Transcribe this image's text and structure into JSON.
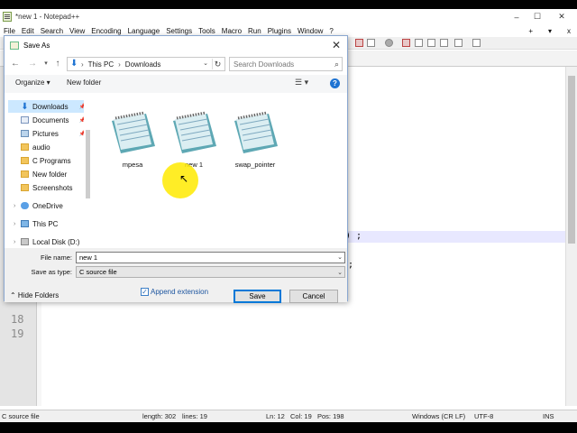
{
  "app": {
    "title": "*new 1 - Notepad++",
    "menu": [
      "File",
      "Edit",
      "Search",
      "View",
      "Encoding",
      "Language",
      "Settings",
      "Tools",
      "Macro",
      "Run",
      "Plugins",
      "Window",
      "?"
    ],
    "menu_right": [
      "+",
      "▾",
      "x"
    ],
    "window_controls": {
      "minimize": "–",
      "maximize": "☐",
      "close": "✕"
    }
  },
  "editor": {
    "line_numbers": [
      "18",
      "19"
    ],
    "code_fragments": [
      ") ;",
      ";"
    ]
  },
  "status_bar": {
    "file_type": "C source file",
    "length": "length: 302",
    "lines": "lines: 19",
    "ln": "Ln: 12",
    "col": "Col: 19",
    "pos": "Pos: 198",
    "eol": "Windows (CR LF)",
    "encoding": "UTF-8",
    "mode": "INS"
  },
  "dialog": {
    "title": "Save As",
    "close_glyph": "✕",
    "nav": {
      "back": "←",
      "forward": "→",
      "recent": "▾",
      "up": "↑"
    },
    "breadcrumb": [
      "This PC",
      "Downloads"
    ],
    "breadcrumb_sep": "›",
    "refresh_glyph": "↻",
    "search_placeholder": "Search Downloads",
    "search_glyph": "⌕",
    "organize": "Organize ▾",
    "new_folder": "New folder",
    "view_glyph": "☰ ▾",
    "help_glyph": "?",
    "tree": [
      {
        "label": "Downloads",
        "icon": "download-icon",
        "pinned": true,
        "selected": true
      },
      {
        "label": "Documents",
        "icon": "document-icon",
        "pinned": true
      },
      {
        "label": "Pictures",
        "icon": "pictures-icon",
        "pinned": true
      },
      {
        "label": "audio",
        "icon": "folder-icon"
      },
      {
        "label": "C Programs",
        "icon": "folder-icon"
      },
      {
        "label": "New folder",
        "icon": "folder-icon"
      },
      {
        "label": "Screenshots",
        "icon": "folder-icon"
      },
      {
        "label": "OneDrive",
        "icon": "onedrive-icon"
      },
      {
        "label": "This PC",
        "icon": "this-pc-icon"
      },
      {
        "label": "Local Disk (D:)",
        "icon": "disk-icon"
      }
    ],
    "pin_glyph": "📌",
    "expand_glyph": "›",
    "files": [
      {
        "name": "mpesa",
        "icon": "notepad-icon"
      },
      {
        "name": "new 1",
        "icon": "notepad-icon"
      },
      {
        "name": "swap_pointer",
        "icon": "notepad-icon"
      }
    ],
    "file_name_label": "File name:",
    "file_name_value": "new 1",
    "save_type_label": "Save as type:",
    "save_type_value": "C source file",
    "dropdown_glyph": "⌄",
    "hide_folders": "⌃  Hide Folders",
    "append_extension": "Append extension",
    "append_checked": "✓",
    "save_button": "Save",
    "cancel_button": "Cancel"
  }
}
